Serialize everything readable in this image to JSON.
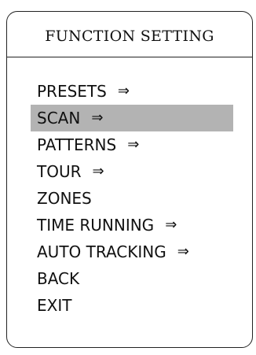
{
  "menu": {
    "title": "FUNCTION SETTING",
    "selected_index": 1,
    "items": [
      {
        "label": "PRESETS",
        "has_submenu": true,
        "icon": "double-arrow-right-icon"
      },
      {
        "label": "SCAN",
        "has_submenu": true,
        "icon": "double-arrow-right-icon"
      },
      {
        "label": "PATTERNS",
        "has_submenu": true,
        "icon": "double-arrow-right-icon"
      },
      {
        "label": "TOUR",
        "has_submenu": true,
        "icon": "double-arrow-right-icon"
      },
      {
        "label": "ZONES",
        "has_submenu": false
      },
      {
        "label": "TIME RUNNING",
        "has_submenu": true,
        "icon": "double-arrow-right-icon"
      },
      {
        "label": "AUTO TRACKING",
        "has_submenu": true,
        "icon": "double-arrow-right-icon"
      },
      {
        "label": "BACK",
        "has_submenu": false
      },
      {
        "label": "EXIT",
        "has_submenu": false
      }
    ]
  },
  "colors": {
    "background": "#ffffff",
    "border": "#222222",
    "text": "#111111",
    "selected_highlight": "#b3b3b3"
  }
}
